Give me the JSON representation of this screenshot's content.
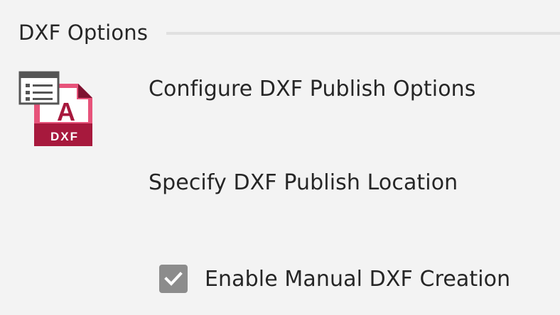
{
  "section": {
    "title": "DXF Options"
  },
  "icon": {
    "name": "dxf-file-icon",
    "letter": "A",
    "caption": "DXF",
    "accent": "#a7193d"
  },
  "links": {
    "configure": "Configure DXF Publish Options",
    "location": "Specify DXF Publish Location"
  },
  "manual_creation": {
    "label": "Enable Manual DXF Creation",
    "checked": true,
    "checkbox_color": "#8c8c8c"
  }
}
